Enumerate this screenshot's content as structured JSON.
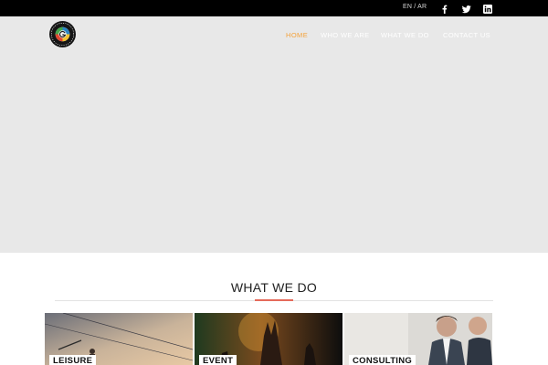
{
  "topbar": {
    "language": "EN / AR",
    "social": [
      "facebook-icon",
      "twitter-icon",
      "linkedin-icon"
    ]
  },
  "nav": {
    "items": [
      {
        "label": "HOME",
        "active": true
      },
      {
        "label": "WHO WE ARE",
        "active": false
      },
      {
        "label": "WHAT WE DO",
        "active": false
      },
      {
        "label": "CONTACT US",
        "active": false
      }
    ]
  },
  "section": {
    "title": "WHAT WE DO"
  },
  "services": [
    {
      "label": "LEISURE"
    },
    {
      "label": "EVENT"
    },
    {
      "label": "CONSULTING"
    }
  ],
  "colors": {
    "topbar": "#000000",
    "hero": "#e8e8e8",
    "nav_active": "#f4a23a",
    "title_accent": "#e56a5a"
  }
}
